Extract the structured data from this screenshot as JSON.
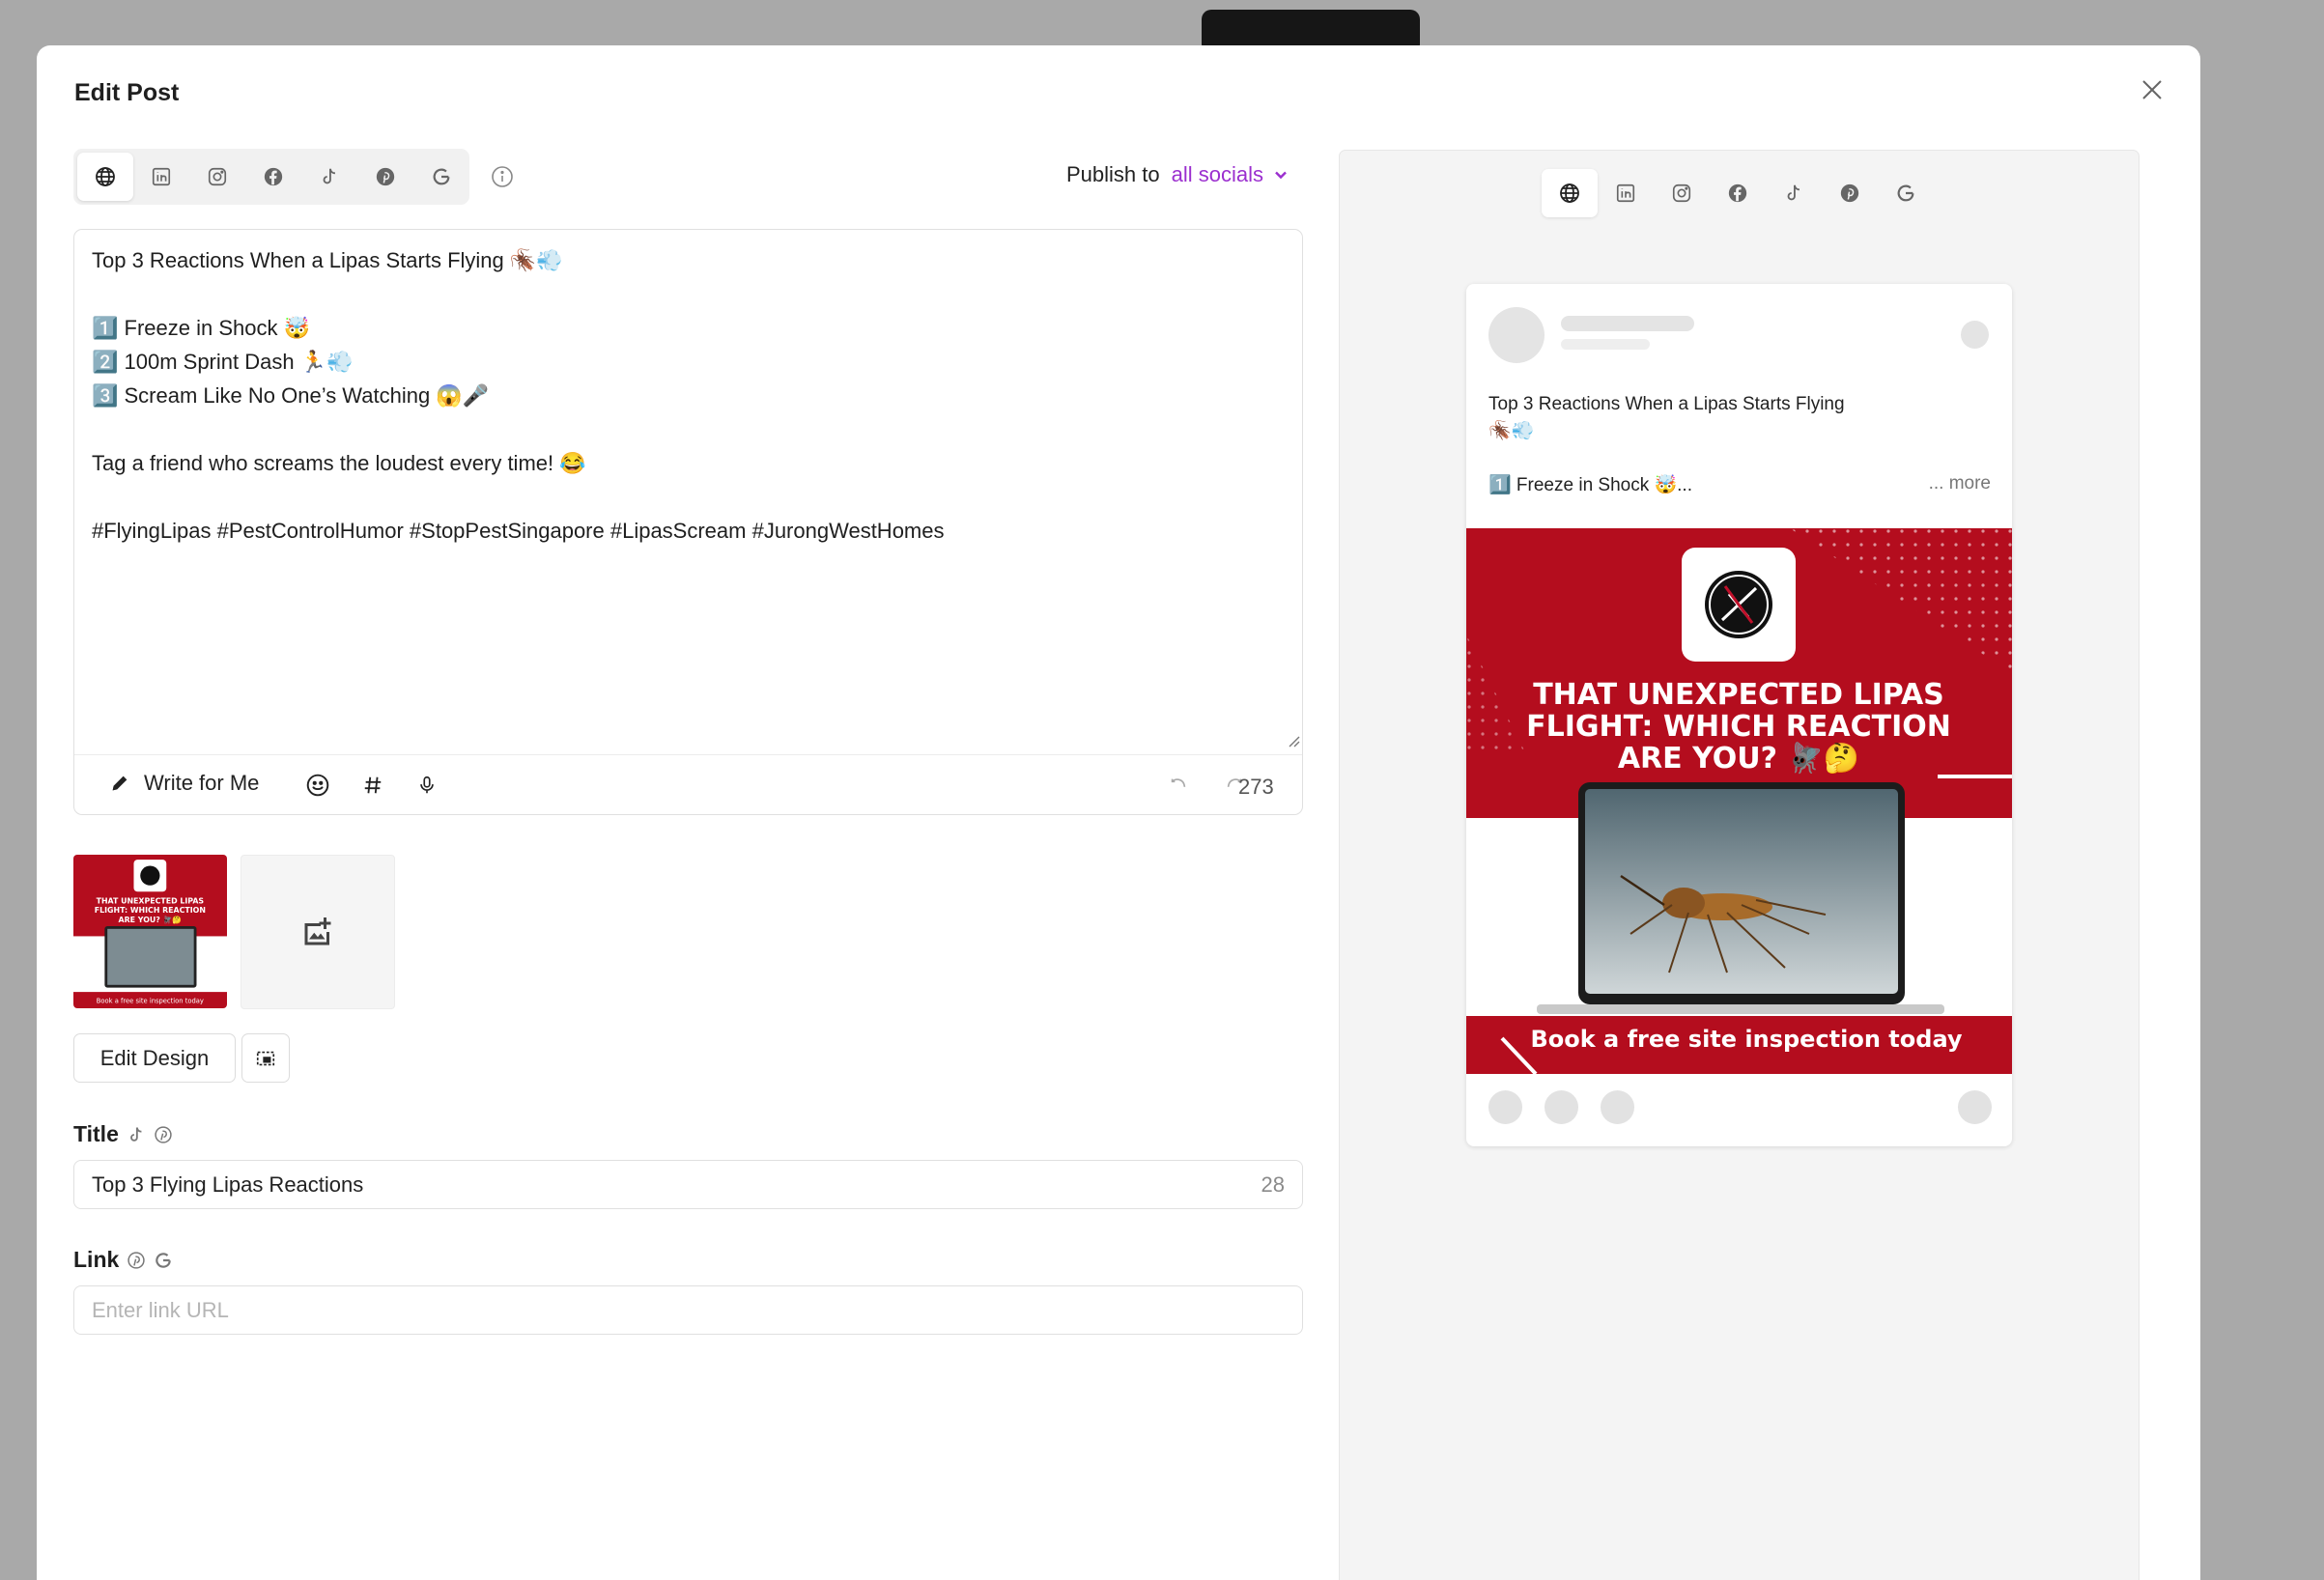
{
  "modal": {
    "title": "Edit Post"
  },
  "network_tabs": [
    {
      "icon": "globe-icon",
      "active": true
    },
    {
      "icon": "linkedin-icon",
      "active": false
    },
    {
      "icon": "instagram-icon",
      "active": false
    },
    {
      "icon": "facebook-icon",
      "active": false
    },
    {
      "icon": "tiktok-icon",
      "active": false
    },
    {
      "icon": "pinterest-icon",
      "active": false
    },
    {
      "icon": "google-icon",
      "active": false
    }
  ],
  "publish": {
    "label": "Publish to",
    "value": "all socials"
  },
  "editor": {
    "lines": [
      "Top 3 Reactions When a Lipas Starts Flying 🪳💨",
      "",
      "1️⃣ Freeze in Shock 🤯",
      "2️⃣ 100m Sprint Dash 🏃💨",
      "3️⃣ Scream Like No One’s Watching 😱🎤",
      "",
      "Tag a friend who screams the loudest every time! 😂",
      "",
      "#FlyingLipas #PestControlHumor #StopPestSingapore #LipasScream #JurongWestHomes"
    ],
    "write_label": "Write for Me",
    "char_count": "273"
  },
  "media": {
    "edit_design_label": "Edit Design",
    "graphic": {
      "headline_lines": [
        "THAT UNEXPECTED LIPAS",
        "FLIGHT: WHICH REACTION",
        "ARE YOU? 🪰🤔"
      ],
      "cta": "Book a free site inspection today"
    }
  },
  "title_field": {
    "label": "Title",
    "value": "Top 3 Flying Lipas Reactions",
    "count": "28"
  },
  "link_field": {
    "label": "Link",
    "placeholder": "Enter link URL"
  },
  "preview": {
    "text_lines": [
      "Top 3 Reactions When a Lipas Starts Flying",
      "🪳💨"
    ],
    "short_line": "1️⃣ Freeze in Shock 🤯...",
    "more_label": "... more"
  },
  "colors": {
    "accent": "#9b2fcf",
    "brand_red": "#b40d1e"
  }
}
